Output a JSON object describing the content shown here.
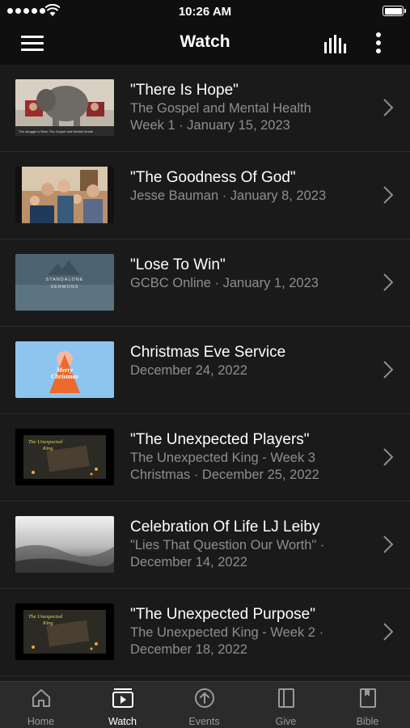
{
  "status_bar": {
    "time": "10:26 AM"
  },
  "header": {
    "title": "Watch"
  },
  "items": [
    {
      "title": "\"There Is Hope\"",
      "line1": "The Gospel and Mental Health",
      "line2": "Week 1 · January 15, 2023"
    },
    {
      "title": "\"The Goodness Of God\"",
      "line1": "Jesse Bauman · January 8, 2023",
      "line2": ""
    },
    {
      "title": "\"Lose To Win\"",
      "line1": "GCBC Online · January 1, 2023",
      "line2": ""
    },
    {
      "title": "Christmas Eve Service",
      "line1": "December 24, 2022",
      "line2": ""
    },
    {
      "title": "\"The Unexpected Players\"",
      "line1": "The Unexpected King - Week 3",
      "line2": "Christmas · December 25, 2022"
    },
    {
      "title": "Celebration Of Life  LJ Leiby",
      "line1": "\"Lies That Question Our Worth\" ·",
      "line2": "December 14, 2022"
    },
    {
      "title": "\"The Unexpected Purpose\"",
      "line1": "The Unexpected King - Week 2 ·",
      "line2": "December 18, 2022"
    }
  ],
  "thumbnails": {
    "hope_caption": "The struggle is Real. The Gospel and Mental Health",
    "standalone_line1": "STANDALONE",
    "standalone_line2": "SERMONS",
    "christmas_line1": "Merry",
    "christmas_line2": "Christmas",
    "unexpected_line1": "The Unexpected",
    "unexpected_line2": "King"
  },
  "tabs": [
    {
      "label": "Home",
      "icon": "home-icon",
      "active": false
    },
    {
      "label": "Watch",
      "icon": "video-icon",
      "active": true
    },
    {
      "label": "Events",
      "icon": "events-icon",
      "active": false
    },
    {
      "label": "Give",
      "icon": "give-icon",
      "active": false
    },
    {
      "label": "Bible",
      "icon": "bible-icon",
      "active": false
    }
  ],
  "colors": {
    "background": "#1a1a1a",
    "bar": "#0f0f0f",
    "secondary_text": "#8e8e93",
    "tab_bar": "#2b2b2b"
  }
}
